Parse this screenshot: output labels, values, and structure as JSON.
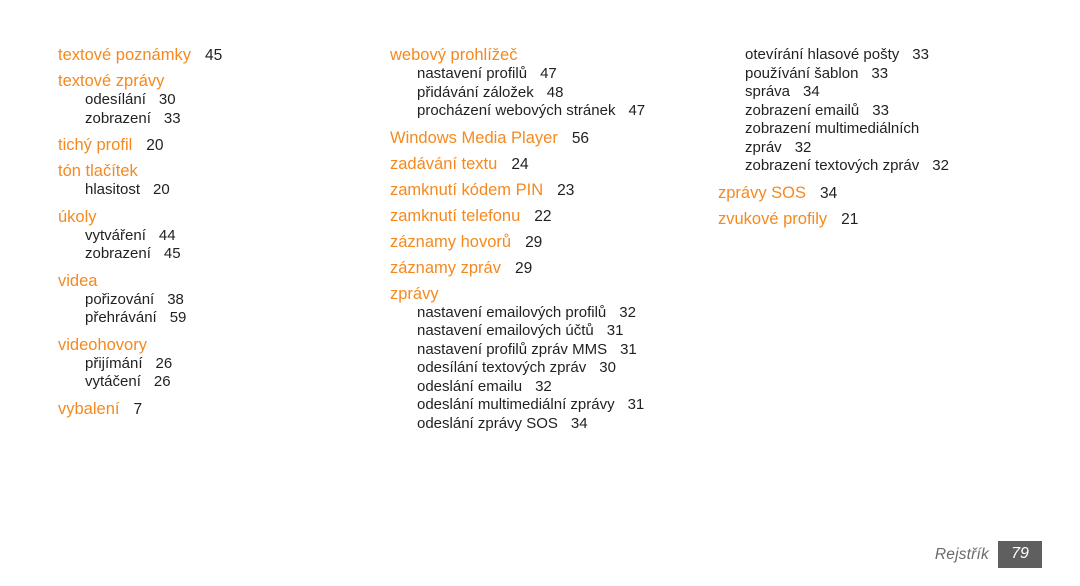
{
  "document": {
    "type": "index-page",
    "language": "cs",
    "background_color": "#ffffff",
    "heading_color": "#f5891f",
    "body_color": "#221f1f",
    "footer_box_color": "#5f5f5f"
  },
  "columns": [
    {
      "id": "column-1",
      "entries": [
        {
          "label": "textové poznámky",
          "page": "45",
          "level": "main"
        },
        {
          "label": "textové zprávy",
          "page": "",
          "level": "main"
        },
        {
          "label": "odesílání",
          "page": "30",
          "level": "sub"
        },
        {
          "label": "zobrazení",
          "page": "33",
          "level": "sub"
        },
        {
          "label": "tichý profil",
          "page": "20",
          "level": "main"
        },
        {
          "label": "tón tlačítek",
          "page": "",
          "level": "main"
        },
        {
          "label": "hlasitost",
          "page": "20",
          "level": "sub"
        },
        {
          "label": "úkoly",
          "page": "",
          "level": "main"
        },
        {
          "label": "vytváření",
          "page": "44",
          "level": "sub"
        },
        {
          "label": "zobrazení",
          "page": "45",
          "level": "sub"
        },
        {
          "label": "videa",
          "page": "",
          "level": "main"
        },
        {
          "label": "pořizování",
          "page": "38",
          "level": "sub"
        },
        {
          "label": "přehrávání",
          "page": "59",
          "level": "sub"
        },
        {
          "label": "videohovory",
          "page": "",
          "level": "main"
        },
        {
          "label": "přijímání",
          "page": "26",
          "level": "sub"
        },
        {
          "label": "vytáčení",
          "page": "26",
          "level": "sub"
        },
        {
          "label": "vybalení",
          "page": "7",
          "level": "main"
        }
      ]
    },
    {
      "id": "column-2",
      "entries": [
        {
          "label": "webový prohlížeč",
          "page": "",
          "level": "main"
        },
        {
          "label": "nastavení profilů",
          "page": "47",
          "level": "sub"
        },
        {
          "label": "přidávání záložek",
          "page": "48",
          "level": "sub"
        },
        {
          "label": "procházení webových stránek",
          "page": "47",
          "level": "sub"
        },
        {
          "label": "Windows Media Player",
          "page": "56",
          "level": "main"
        },
        {
          "label": "zadávání textu",
          "page": "24",
          "level": "main"
        },
        {
          "label": "zamknutí kódem PIN",
          "page": "23",
          "level": "main"
        },
        {
          "label": "zamknutí telefonu",
          "page": "22",
          "level": "main"
        },
        {
          "label": "záznamy hovorů",
          "page": "29",
          "level": "main"
        },
        {
          "label": "záznamy zpráv",
          "page": "29",
          "level": "main"
        },
        {
          "label": "zprávy",
          "page": "",
          "level": "main"
        },
        {
          "label": "nastavení emailových profilů",
          "page": "32",
          "level": "sub"
        },
        {
          "label": "nastavení emailových účtů",
          "page": "31",
          "level": "sub"
        },
        {
          "label": "nastavení profilů zpráv MMS",
          "page": "31",
          "level": "sub"
        },
        {
          "label": "odesílání textových zpráv",
          "page": "30",
          "level": "sub"
        },
        {
          "label": "odeslání emailu",
          "page": "32",
          "level": "sub"
        },
        {
          "label": "odeslání multimediální zprávy",
          "page": "31",
          "level": "sub"
        },
        {
          "label": "odeslání zprávy SOS",
          "page": "34",
          "level": "sub"
        }
      ]
    },
    {
      "id": "column-3",
      "entries": [
        {
          "label": "otevírání hlasové pošty",
          "page": "33",
          "level": "sub"
        },
        {
          "label": "používání šablon",
          "page": "33",
          "level": "sub"
        },
        {
          "label": "správa",
          "page": "34",
          "level": "sub"
        },
        {
          "label": "zobrazení emailů",
          "page": "33",
          "level": "sub"
        },
        {
          "label": "zobrazení multimediálních",
          "page": "",
          "level": "sub"
        },
        {
          "label": "zpráv",
          "page": "32",
          "level": "sub"
        },
        {
          "label": "zobrazení textových zpráv",
          "page": "32",
          "level": "sub"
        },
        {
          "label": "zprávy SOS",
          "page": "34",
          "level": "main"
        },
        {
          "label": "zvukové profily",
          "page": "21",
          "level": "main"
        }
      ]
    }
  ],
  "footer": {
    "label": "Rejstřík",
    "page_number": "79"
  }
}
